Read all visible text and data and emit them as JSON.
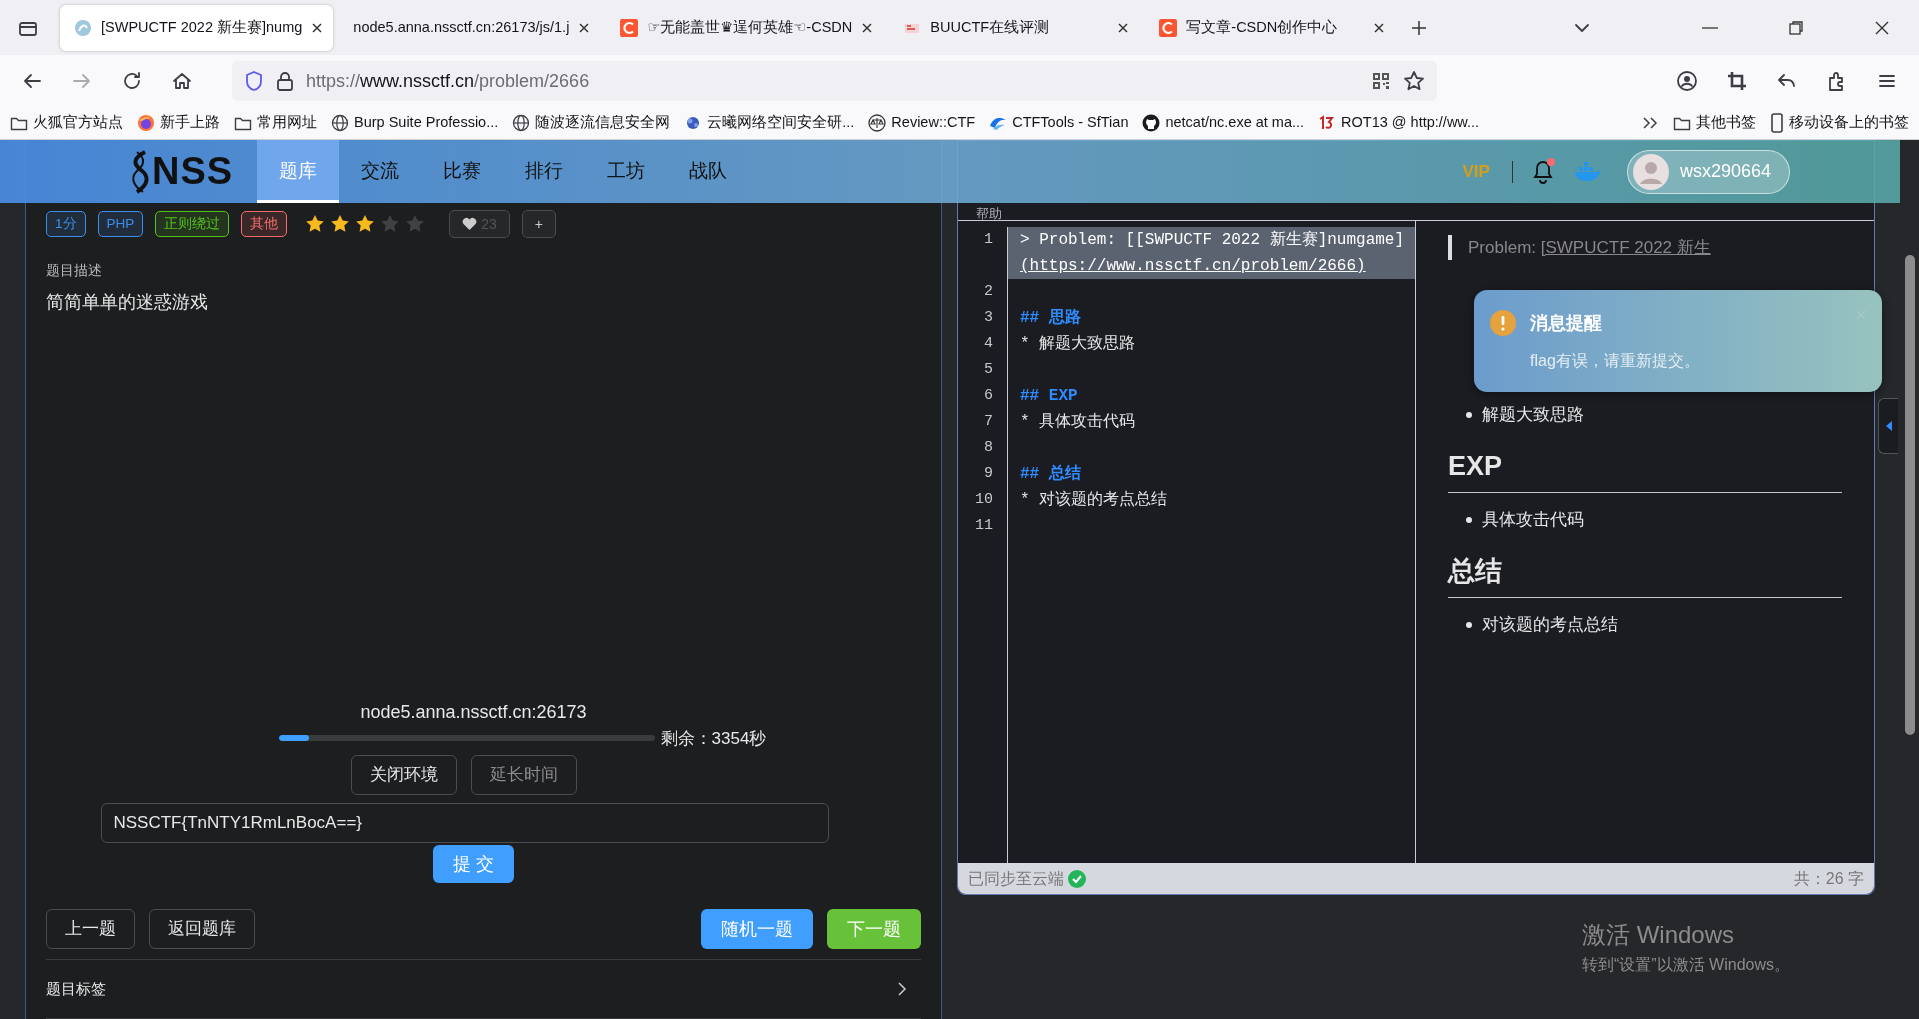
{
  "browser": {
    "tabs": [
      {
        "title": "[SWPUCTF 2022 新生赛]numg",
        "kind": "nss",
        "selected": true
      },
      {
        "title": "node5.anna.nssctf.cn:26173/js/1.j",
        "kind": "plain",
        "selected": false
      },
      {
        "title": "☞无能盖世♛逞何英雄☜-CSDN",
        "kind": "csdn",
        "selected": false
      },
      {
        "title": "BUUCTF在线评测",
        "kind": "buu",
        "selected": false
      },
      {
        "title": "写文章-CSDN创作中心",
        "kind": "csdn",
        "selected": false
      }
    ],
    "url": {
      "scheme": "https://",
      "host": "www.nssctf.cn",
      "path": "/problem/2666"
    },
    "forward_disabled": true,
    "bookmarks": [
      {
        "label": "火狐官方站点",
        "kind": "folder"
      },
      {
        "label": "新手上路",
        "kind": "firefox"
      },
      {
        "label": "常用网址",
        "kind": "folder"
      },
      {
        "label": "Burp Suite Professio...",
        "kind": "globe"
      },
      {
        "label": "随波逐流信息安全网",
        "kind": "globe"
      },
      {
        "label": "云曦网络空间安全研...",
        "kind": "cloud"
      },
      {
        "label": "Review::CTF",
        "kind": "scale"
      },
      {
        "label": "CTFTools - SfTian",
        "kind": "wave"
      },
      {
        "label": "netcat/nc.exe at ma...",
        "kind": "github"
      },
      {
        "label": "ROT13 @ http://ww...",
        "kind": "rot"
      }
    ],
    "other_bookmarks": [
      {
        "label": "其他书签",
        "kind": "folder"
      },
      {
        "label": "移动设备上的书签",
        "kind": "mobile"
      }
    ]
  },
  "site": {
    "logo": "NSS",
    "nav": [
      {
        "label": "题库",
        "selected": true
      },
      {
        "label": "交流",
        "selected": false
      },
      {
        "label": "比赛",
        "selected": false
      },
      {
        "label": "排行",
        "selected": false
      },
      {
        "label": "工坊",
        "selected": false
      },
      {
        "label": "战队",
        "selected": false
      }
    ],
    "vip": "VIP",
    "unread": true,
    "username": "wsx290664"
  },
  "problem": {
    "tags": [
      {
        "label": "1分",
        "color": "#3b8eea"
      },
      {
        "label": "PHP",
        "color": "#3b8eea"
      },
      {
        "label": "正则绕过",
        "color": "#52c41a"
      },
      {
        "label": "其他",
        "color": "#f56c6c"
      }
    ],
    "stars": 3,
    "likes": "23",
    "add": "+",
    "description_label": "题目描述",
    "description": "简简单单的迷惑游戏",
    "instance": {
      "address": "node5.anna.nssctf.cn:26173",
      "level": 0.08,
      "remaining": "剩余：3354秒",
      "buttons": [
        {
          "label": "关闭环境",
          "disabled": false
        },
        {
          "label": "延长时间",
          "disabled": true
        }
      ]
    },
    "flag_input": {
      "value": "NSSCTF{TnNTY1RmLnBocA==}"
    },
    "submit": "提 交",
    "nav_buttons": [
      {
        "label": "上一题",
        "kind": "outline"
      },
      {
        "label": "返回题库",
        "kind": "outline"
      },
      {
        "label": "随机一题",
        "kind": "primary"
      },
      {
        "label": "下一题",
        "kind": "success"
      }
    ],
    "section": "题目标签"
  },
  "editor": {
    "help": "帮助",
    "lines": [
      {
        "number": "1",
        "kind": "quote",
        "text": "> Problem: [[SWPUCTF 2022 新生赛]numgame]",
        "link": "(https://www.nssctf.cn/problem/2666)"
      },
      {
        "number": "2",
        "kind": "blank"
      },
      {
        "number": "3",
        "kind": "heading",
        "text": "## 思路"
      },
      {
        "number": "4",
        "kind": "bullet",
        "text": "* 解题大致思路"
      },
      {
        "number": "5",
        "kind": "blank"
      },
      {
        "number": "6",
        "kind": "heading",
        "text": "## EXP"
      },
      {
        "number": "7",
        "kind": "bullet",
        "text": "* 具体攻击代码"
      },
      {
        "number": "8",
        "kind": "blank"
      },
      {
        "number": "9",
        "kind": "heading",
        "text": "## 总结"
      },
      {
        "number": "10",
        "kind": "bullet",
        "text": "* 对该题的考点总结"
      },
      {
        "number": "11",
        "kind": "blank"
      }
    ],
    "preview": [
      {
        "kind": "quote",
        "text": "Problem: ",
        "link": "[SWPUCTF 2022 新生"
      },
      {
        "kind": "bullet",
        "text": "解题大致思路"
      },
      {
        "kind": "heading",
        "text": "EXP"
      },
      {
        "kind": "bullet",
        "text": "具体攻击代码"
      },
      {
        "kind": "heading",
        "text": "总结"
      },
      {
        "kind": "bullet",
        "text": "对该题的考点总结"
      }
    ],
    "status": "已同步至云端",
    "synced": true,
    "count": "共：26 字"
  },
  "toast": {
    "title": "消息提醒",
    "message": "flag有误，请重新提交。"
  },
  "os_notice": {
    "title": "激活 Windows",
    "subtitle": "转到“设置”以激活 Windows。"
  }
}
